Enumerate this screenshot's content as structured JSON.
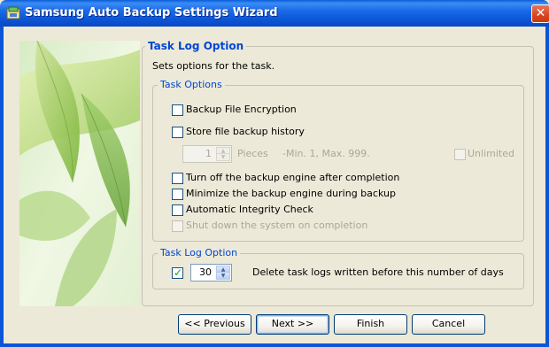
{
  "window": {
    "title": "Samsung Auto Backup Settings Wizard",
    "close_glyph": "✕",
    "app_icon": "samsung-backup-icon"
  },
  "section": {
    "title": "Task Log Option",
    "description": "Sets options for the task."
  },
  "task_options": {
    "legend": "Task Options",
    "backup_encryption": {
      "label": "Backup File Encryption",
      "checked": false
    },
    "store_history": {
      "label": "Store file backup history",
      "checked": false
    },
    "pieces": {
      "value": "1",
      "unit": "Pieces",
      "range_hint": "-Min. 1, Max. 999.",
      "unlimited_label": "Unlimited",
      "enabled": false
    },
    "turn_off_engine": {
      "label": "Turn off the backup engine after completion",
      "checked": false
    },
    "minimize_engine": {
      "label": "Minimize the backup engine during backup",
      "checked": false
    },
    "integrity_check": {
      "label": "Automatic Integrity Check",
      "checked": false
    },
    "shutdown": {
      "label": "Shut down the system on completion",
      "checked": false,
      "enabled": false
    }
  },
  "task_log": {
    "legend": "Task Log Option",
    "checked": true,
    "days": "30",
    "label": "Delete task logs written before this number of days"
  },
  "buttons": {
    "previous": "<< Previous",
    "next": "Next >>",
    "finish": "Finish",
    "cancel": "Cancel"
  },
  "colors": {
    "titlebar": "#0b55d6",
    "legend_text": "#0046d5",
    "dialog_bg": "#ece9d8",
    "close_button": "#d9451e"
  }
}
